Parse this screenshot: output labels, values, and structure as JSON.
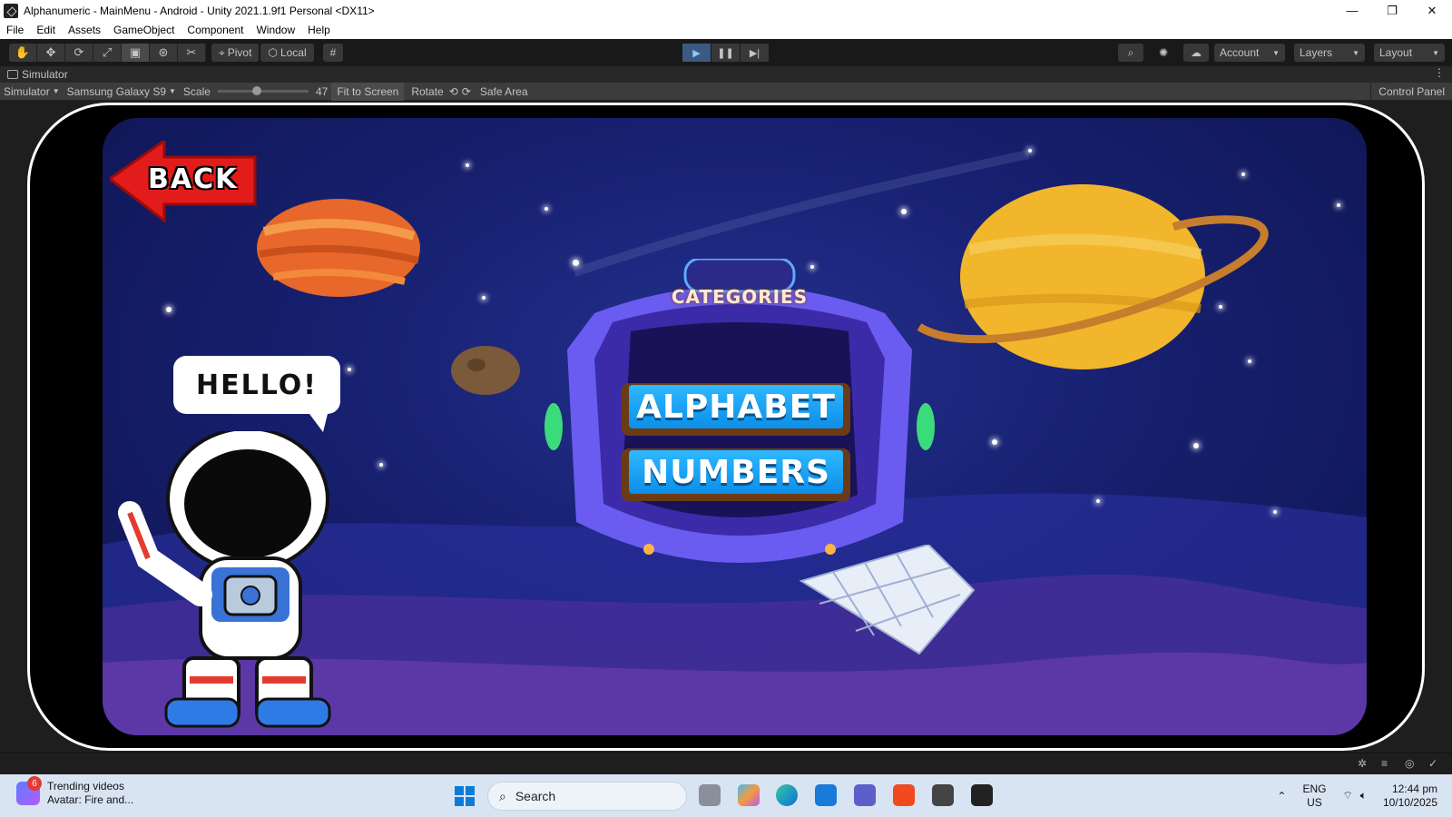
{
  "window": {
    "title": "Alphanumeric - MainMenu - Android - Unity 2021.1.9f1 Personal <DX11>",
    "controls": {
      "minimize": "—",
      "restore": "❐",
      "close": "✕"
    }
  },
  "menubar": {
    "items": [
      "File",
      "Edit",
      "Assets",
      "GameObject",
      "Component",
      "Window",
      "Help"
    ]
  },
  "toolbar": {
    "tools": [
      "hand-icon",
      "move-icon",
      "rotate-icon",
      "scale-icon",
      "rect-icon",
      "transform-icon",
      "custom-tool-icon"
    ],
    "pivot_label": "Pivot",
    "local_label": "Local",
    "account_label": "Account",
    "layers_label": "Layers",
    "layout_label": "Layout"
  },
  "tab": {
    "label": "Simulator"
  },
  "simulator_bar": {
    "mode": "Simulator",
    "device": "Samsung Galaxy S9",
    "scale_label": "Scale",
    "scale_value": "47",
    "scale_fraction": 0.42,
    "fit_label": "Fit to Screen",
    "rotate_label": "Rotate",
    "safe_area_label": "Safe Area",
    "control_panel_label": "Control Panel"
  },
  "game": {
    "back_label": "BACK",
    "speech": "HELLO!",
    "categories_title": "CATEGORIES",
    "buttons": [
      "ALPHABET",
      "NUMBERS"
    ],
    "colors": {
      "back_red": "#e21b1b",
      "button_blue": "#1ba6f6",
      "button_border": "#6b3b16",
      "planet_orange": "#e8672a",
      "planet_yellow": "#f1b62c"
    }
  },
  "taskbar": {
    "news_badge": "6",
    "news_title": "Trending videos",
    "news_subtitle": "Avatar: Fire and...",
    "search_placeholder": "Search",
    "lang_top": "ENG",
    "lang_bottom": "US",
    "time": "12:44 pm",
    "date": "10/10/2025"
  }
}
